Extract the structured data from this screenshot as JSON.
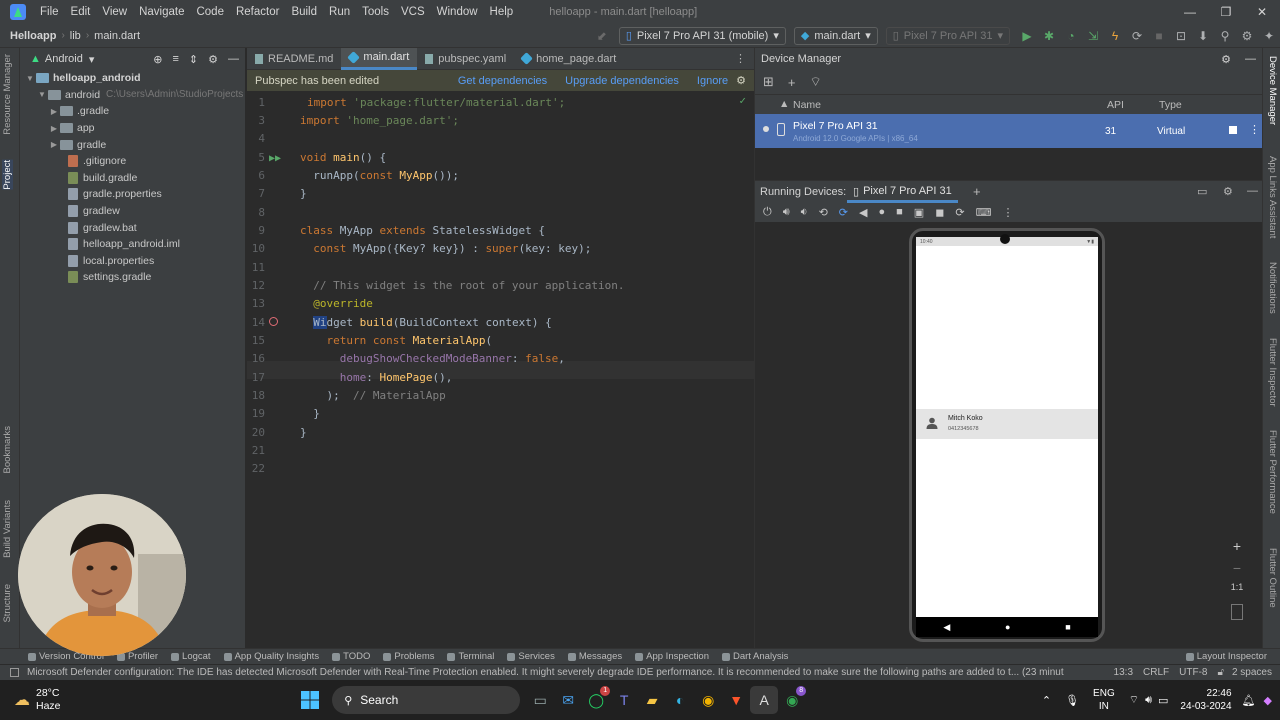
{
  "menubar": {
    "items": [
      "File",
      "Edit",
      "View",
      "Navigate",
      "Code",
      "Refactor",
      "Build",
      "Run",
      "Tools",
      "VCS",
      "Window",
      "Help"
    ],
    "window_title": "helloapp - main.dart [helloapp]"
  },
  "navbar": {
    "project": "Helloapp",
    "folder": "lib",
    "file": "main.dart",
    "device_select": "Pixel 7 Pro API 31 (mobile)",
    "run_config": "main.dart",
    "avd_select": "Pixel 7 Pro API 31"
  },
  "left_strip": {
    "resource_manager": "Resource Manager",
    "project": "Project",
    "bookmarks": "Bookmarks",
    "build_variants": "Build Variants",
    "structure": "Structure"
  },
  "project_panel": {
    "view_mode": "Android",
    "root": "helloapp_android",
    "android": "android",
    "android_path": "C:\\Users\\Admin\\StudioProjects",
    "children": [
      ".gradle",
      "app",
      "gradle"
    ],
    "files": [
      ".gitignore",
      "build.gradle",
      "gradle.properties",
      "gradlew",
      "gradlew.bat",
      "helloapp_android.iml",
      "local.properties",
      "settings.gradle"
    ]
  },
  "editor": {
    "tabs": [
      "README.md",
      "main.dart",
      "pubspec.yaml",
      "home_page.dart"
    ],
    "active_tab": "main.dart",
    "banner": {
      "message": "Pubspec has been edited",
      "get_deps": "Get dependencies",
      "upgrade_deps": "Upgrade dependencies",
      "ignore": "Ignore"
    },
    "line_numbers": [
      "1",
      "3",
      "4",
      "5",
      "6",
      "7",
      "8",
      "9",
      "10",
      "11",
      "12",
      "13",
      "14",
      "15",
      "16",
      "17",
      "18",
      "19",
      "20",
      "21",
      "22"
    ],
    "code": {
      "l1_kw": "import",
      "l1_str": "'package:flutter/material.dart';",
      "l3_kw": "import",
      "l3_str": "'home_page.dart';",
      "l5_kw": "void",
      "l5_fn": "main",
      "l5_rest": "() {",
      "l6_a": "  runApp(",
      "l6_kw": "const",
      "l6_fn": "MyApp",
      "l6_b": "());",
      "l7": "}",
      "l9_kw1": "class",
      "l9_name": " MyApp ",
      "l9_kw2": "extends",
      "l9_rest": " StatelessWidget {",
      "l10_kw": "  const",
      "l10_a": " MyApp({Key? key}) : ",
      "l10_kw2": "super",
      "l10_b": "(key: key);",
      "l12_cm": "  // This widget is the root of your application.",
      "l13_ann": "  @override",
      "l14_sel": "Wi",
      "l14_a": "dget",
      "l14_fn": " build",
      "l14_b": "(BuildContext context) {",
      "l15_kw": "    return const",
      "l15_fn": " MaterialApp",
      "l15_b": "(",
      "l16_fld": "      debugShowCheckedModeBanner",
      "l16_a": ": ",
      "l16_kw": "false",
      "l16_b": ",",
      "l17_fld": "      home",
      "l17_a": ": ",
      "l17_fn": "HomePage",
      "l17_b": "(),",
      "l18_a": "    );",
      "l18_cm": "  // MaterialApp",
      "l19": "  }",
      "l20": "}"
    }
  },
  "device_manager": {
    "title": "Device Manager",
    "col_name": "Name",
    "col_api": "API",
    "col_type": "Type",
    "device_name": "Pixel 7 Pro API 31",
    "device_sub": "Android 12.0 Google APIs | x86_64",
    "device_api": "31",
    "device_type": "Virtual",
    "running_label": "Running Devices:",
    "running_tab": "Pixel 7 Pro API 31",
    "phone": {
      "contact_name": "Mitch Koko",
      "contact_phone": "0412345678",
      "time": "10:40"
    },
    "zoom_in": "+",
    "zoom_out": "−",
    "zoom_ratio": "1:1"
  },
  "right_strip": {
    "device_manager": "Device Manager",
    "app_links": "App Links Assistant",
    "notifications": "Notifications",
    "flutter_inspector": "Flutter Inspector",
    "flutter_performance": "Flutter Performance",
    "flutter_outline": "Flutter Outline"
  },
  "bottom_tools": [
    "Version Control",
    "Profiler",
    "Logcat",
    "App Quality Insights",
    "TODO",
    "Problems",
    "Terminal",
    "Services",
    "Messages",
    "App Inspection",
    "Dart Analysis",
    "Layout Inspector"
  ],
  "status": {
    "message": "Microsoft Defender configuration: The IDE has detected Microsoft Defender with Real-Time Protection enabled. It might severely degrade IDE performance. It is recommended to make sure the following paths are added to t... (23 minut",
    "position": "13:3",
    "line_sep": "CRLF",
    "encoding": "UTF-8",
    "indent": "2 spaces"
  },
  "taskbar": {
    "weather_temp": "28°C",
    "weather_desc": "Haze",
    "search": "Search",
    "lang_1": "ENG",
    "lang_2": "IN",
    "time": "22:46",
    "date": "24-03-2024",
    "badge_whatsapp": "1",
    "badge_chrome": "8"
  },
  "colors": {
    "ide_bg": "#2b2b2b",
    "panel_bg": "#3c3f41",
    "selection": "#4b6eaf",
    "link": "#589df6",
    "keyword": "#cc7832",
    "string": "#6a8759",
    "function": "#ffc66d"
  }
}
